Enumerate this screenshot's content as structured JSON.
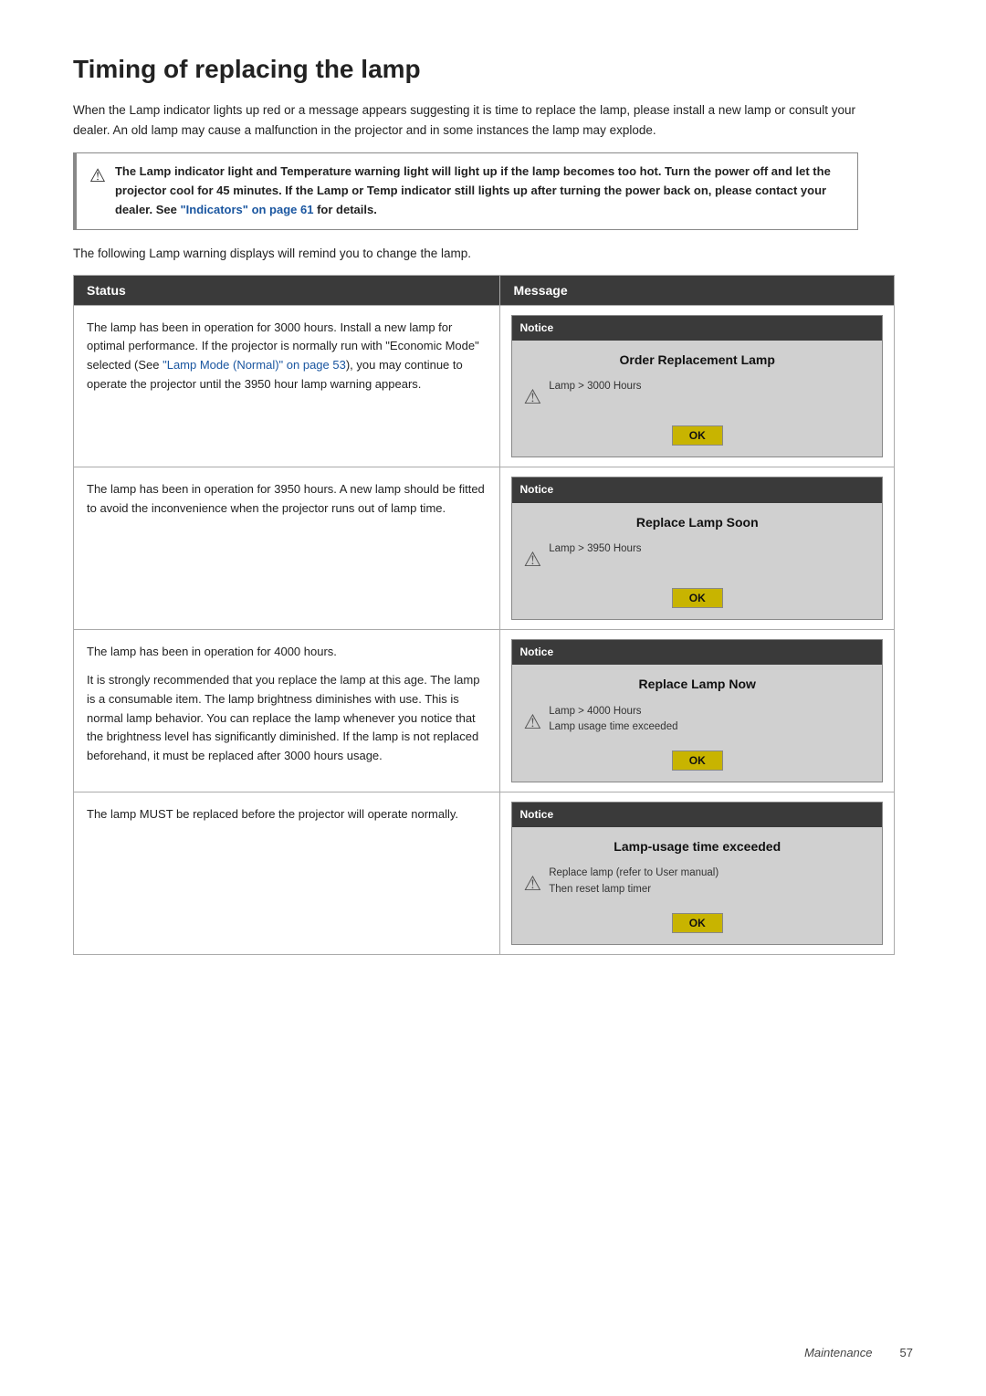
{
  "page": {
    "title": "Timing of replacing the lamp",
    "intro": "When the Lamp indicator lights up red or a message appears suggesting it is time to replace the lamp, please install a new lamp or consult your dealer. An old lamp may cause a malfunction in the projector and in some instances the lamp may explode.",
    "warning": "The Lamp indicator light and Temperature warning light will light up if the lamp becomes too hot. Turn the power off and let the projector cool for 45 minutes. If the Lamp or Temp indicator still lights up after turning the power back on, please contact your dealer. See \"Indicators\" on page 61 for details.",
    "warning_link_text": "\"Indicators\" on page 61",
    "sub_intro": "The following Lamp warning displays will remind you to change the lamp.",
    "table": {
      "col1_header": "Status",
      "col2_header": "Message",
      "rows": [
        {
          "status": "The lamp has been in operation for 3000 hours. Install a new lamp for optimal performance. If the projector is normally run with \"Economic Mode\" selected (See \"Lamp Mode (Normal)\" on page 53), you may continue to operate the projector until the 3950 hour lamp warning appears.",
          "status_link1_text": "\"Lamp Mode (Normal)\" on page 53",
          "msg_title": "Order Replacement Lamp",
          "msg_notice": "Notice",
          "msg_detail": "Lamp > 3000 Hours",
          "msg_ok": "OK"
        },
        {
          "status": "The lamp has been in operation for 3950 hours. A new lamp should be fitted to avoid the inconvenience when the projector runs out of lamp time.",
          "msg_title": "Replace Lamp Soon",
          "msg_notice": "Notice",
          "msg_detail": "Lamp > 3950 Hours",
          "msg_ok": "OK"
        },
        {
          "status_lines": [
            "The lamp has been in operation for 4000 hours.",
            "It is strongly recommended that you replace the lamp at this age. The lamp is a consumable item. The lamp brightness diminishes with use. This is normal lamp behavior. You can replace the lamp whenever you notice that the brightness level has significantly diminished. If the lamp is not replaced beforehand, it must be replaced after 3000 hours usage."
          ],
          "msg_title": "Replace Lamp Now",
          "msg_notice": "Notice",
          "msg_detail_line1": "Lamp > 4000 Hours",
          "msg_detail_line2": "Lamp usage time exceeded",
          "msg_ok": "OK"
        },
        {
          "status": "The lamp MUST be replaced before the projector will operate normally.",
          "msg_title": "Lamp-usage time exceeded",
          "msg_notice": "Notice",
          "msg_detail_line1": "Replace lamp (refer to User manual)",
          "msg_detail_line2": "Then reset lamp timer",
          "msg_ok": "OK"
        }
      ]
    },
    "footer": {
      "word": "Maintenance",
      "page_num": "57"
    }
  }
}
